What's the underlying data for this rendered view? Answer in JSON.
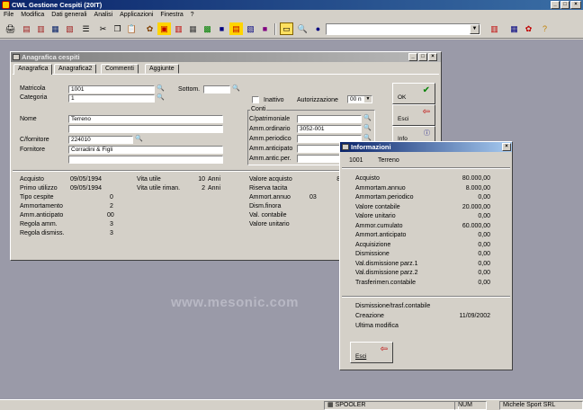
{
  "app": {
    "title": "CWL Gestione Cespiti (20IT)"
  },
  "menu": [
    "File",
    "Modifica",
    "Dati generali",
    "Analisi",
    "Applicazioni",
    "Finestra",
    "?"
  ],
  "toolbar": {
    "combo_value": ""
  },
  "anagrafica": {
    "title": "Anagrafica cespiti",
    "tabs": [
      "Anagrafica",
      "Anagrafica2",
      "Commenti",
      "Aggiunte"
    ],
    "labels": {
      "matricola": "Matricola",
      "categoria": "Categoria",
      "sottom": "Sottom.",
      "inattivo": "Inattivo",
      "autorizzazione": "Autorizzazione",
      "nome": "Nome",
      "cfornitore": "C/fornitore",
      "fornitore": "Fornitore",
      "conti": "Conti",
      "cpatrimoniale": "C/patrimoniale",
      "ammordinario": "Amm.ordinario",
      "ammperiodico": "Amm.periodico",
      "ammanticipato": "Amm.anticipato",
      "ammanticper": "Amm.antic.per."
    },
    "values": {
      "matricola": "1001",
      "categoria": "1",
      "sottom": "",
      "autorizzazione": "00 n",
      "nome": "Terreno",
      "nome2": "",
      "cfornitore": "224010",
      "fornitore": "Corradini & Figli",
      "fornitore2": "",
      "cpatrimoniale": "",
      "ammordinario": "3052-001",
      "ammperiodico": "",
      "ammanticipato": "",
      "ammanticper": ""
    },
    "side_buttons": {
      "ok": "OK",
      "esci": "Esci",
      "info": "Info"
    },
    "summary_left": [
      {
        "label": "Acquisto",
        "value": "09/05/1994"
      },
      {
        "label": "Primo utilizzo",
        "value": "09/05/1994"
      },
      {
        "label": "Tipo cespite",
        "value": "0"
      },
      {
        "label": "Ammortamento",
        "value": "2"
      },
      {
        "label": "Amm.anticipato",
        "value": "00"
      },
      {
        "label": "Regola amm.",
        "value": "3"
      },
      {
        "label": "Regola dismiss.",
        "value": "3"
      }
    ],
    "summary_mid": [
      {
        "label": "Vita utile",
        "value": "10",
        "unit": "Anni"
      },
      {
        "label": "Vita utile riman.",
        "value": "2",
        "unit": "Anni"
      }
    ],
    "summary_right": [
      {
        "label": "Valore acquisto",
        "value": "80"
      },
      {
        "label": "Riserva tacita",
        "value": ""
      },
      {
        "label": "Ammort.annuo",
        "value": "03"
      },
      {
        "label": "Dism.finora",
        "value": ""
      },
      {
        "label": "Val. contabile",
        "value": ""
      },
      {
        "label": "Valore unitario",
        "value": ""
      }
    ]
  },
  "info": {
    "title": "Informazioni",
    "code": "1001",
    "name": "Terreno",
    "rows": [
      {
        "label": "Acquisto",
        "value": "80.000,00"
      },
      {
        "label": "Ammortam.annuo",
        "value": "8.000,00"
      },
      {
        "label": "Ammortam.periodico",
        "value": "0,00"
      },
      {
        "label": "Valore contabile",
        "value": "20.000,00"
      },
      {
        "label": "Valore unitario",
        "value": "0,00"
      },
      {
        "label": "Ammor.cumulato",
        "value": "60.000,00"
      },
      {
        "label": "Ammort.anticipato",
        "value": "0,00"
      },
      {
        "label": "Acquisizione",
        "value": "0,00"
      },
      {
        "label": "Dismissione",
        "value": "0,00"
      },
      {
        "label": "Val.dismissione parz.1",
        "value": "0,00"
      },
      {
        "label": "Val.dismissione parz.2",
        "value": "0,00"
      },
      {
        "label": "Trasferimen.contabile",
        "value": "0,00"
      }
    ],
    "footer_rows": [
      {
        "label": "Dismissione/trasf.contabile",
        "value": ""
      },
      {
        "label": "Creazione",
        "value": "11/09/2002"
      },
      {
        "label": "Ultima modifica",
        "value": ""
      }
    ],
    "exit_label": "Esci"
  },
  "watermark": "www.mesonic.com",
  "status": {
    "spooler": "SPOOLER",
    "num": "NUM",
    "company": "Michele Sport SRL"
  }
}
